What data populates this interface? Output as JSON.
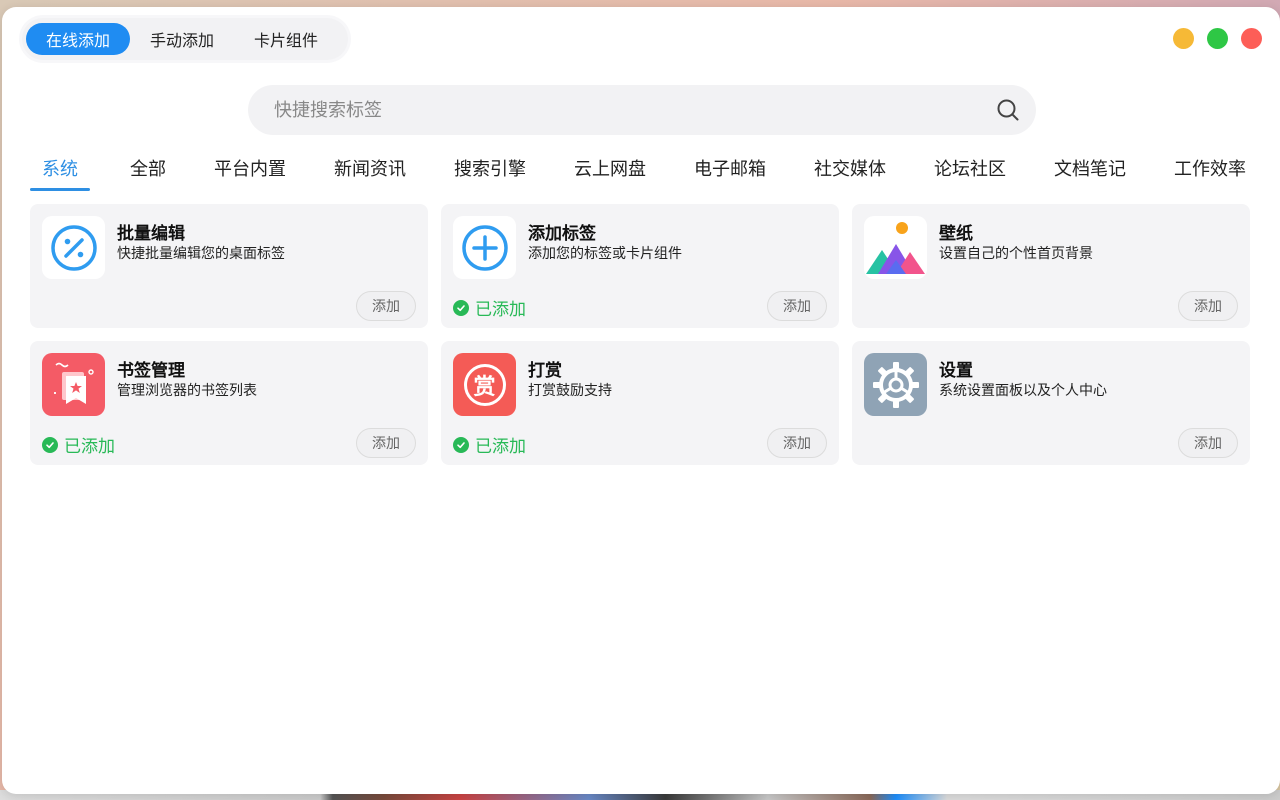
{
  "mode_tabs": [
    {
      "label": "在线添加",
      "active": true
    },
    {
      "label": "手动添加",
      "active": false
    },
    {
      "label": "卡片组件",
      "active": false
    }
  ],
  "search": {
    "placeholder": "快捷搜索标签"
  },
  "categories": [
    {
      "label": "系统",
      "active": true
    },
    {
      "label": "全部"
    },
    {
      "label": "平台内置"
    },
    {
      "label": "新闻资讯"
    },
    {
      "label": "搜索引擎"
    },
    {
      "label": "云上网盘"
    },
    {
      "label": "电子邮箱"
    },
    {
      "label": "社交媒体"
    },
    {
      "label": "论坛社区"
    },
    {
      "label": "文档笔记"
    },
    {
      "label": "工作效率"
    }
  ],
  "cards": [
    {
      "title": "批量编辑",
      "desc": "快捷批量编辑您的桌面标签",
      "icon": "percent-circle-icon",
      "added": false,
      "add_label": "添加"
    },
    {
      "title": "添加标签",
      "desc": "添加您的标签或卡片组件",
      "icon": "plus-circle-icon",
      "added": true,
      "added_label": "已添加",
      "add_label": "添加"
    },
    {
      "title": "壁纸",
      "desc": "设置自己的个性首页背景",
      "icon": "wallpaper-icon",
      "added": false,
      "add_label": "添加"
    },
    {
      "title": "书签管理",
      "desc": "管理浏览器的书签列表",
      "icon": "bookmark-icon",
      "added": true,
      "added_label": "已添加",
      "add_label": "添加"
    },
    {
      "title": "打赏",
      "desc": "打赏鼓励支持",
      "icon": "reward-icon",
      "icon_glyph": "赏",
      "added": true,
      "added_label": "已添加",
      "add_label": "添加"
    },
    {
      "title": "设置",
      "desc": "系统设置面板以及个人中心",
      "icon": "gear-icon",
      "added": false,
      "add_label": "添加"
    }
  ],
  "colors": {
    "accent": "#1f8cf2",
    "category_active": "#2e8fe3",
    "added_green": "#28b957",
    "window_yellow": "#f6b936",
    "window_green": "#2ec745",
    "window_red": "#fd5e57"
  }
}
